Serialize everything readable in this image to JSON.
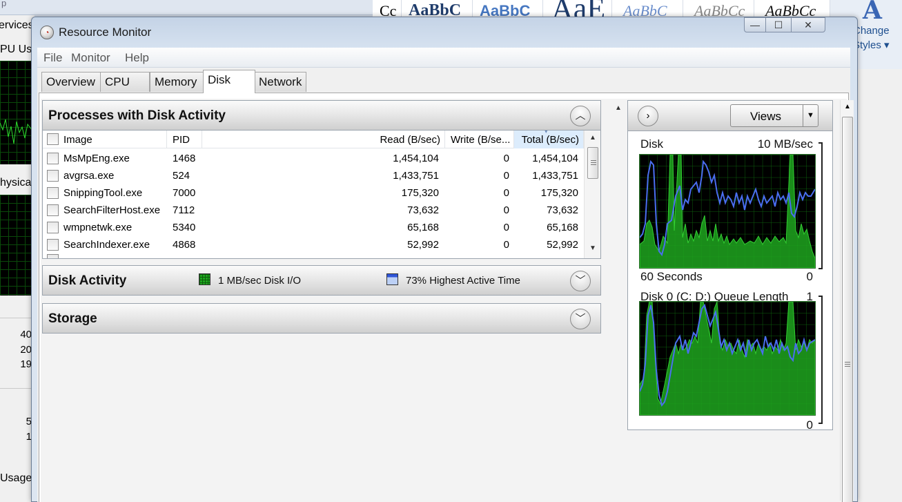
{
  "background": {
    "task_manager": {
      "tab_text": "ervices",
      "labels": [
        "PU Us",
        "hysica",
        "Usage"
      ],
      "numbers": [
        "40",
        "20",
        "19",
        "5",
        "1"
      ]
    },
    "word_ribbon": {
      "styles": [
        "Cc",
        "AaBbC",
        "AaBbC",
        "AaE",
        "AaBbC",
        "AaBbCc",
        "AaBbCc"
      ],
      "change_styles": [
        "Change",
        "Styles"
      ]
    }
  },
  "window": {
    "title": "Resource Monitor",
    "controls": {
      "minimize": "—",
      "maximize": "☐",
      "close": "✕"
    },
    "menu": [
      "File",
      "Monitor",
      "Help"
    ],
    "tabs": [
      "Overview",
      "CPU",
      "Memory",
      "Disk",
      "Network"
    ],
    "active_tab": "Disk"
  },
  "processes_panel": {
    "title": "Processes with Disk Activity",
    "columns": [
      "Image",
      "PID",
      "Read (B/sec)",
      "Write (B/se...",
      "Total (B/sec)"
    ],
    "rows": [
      {
        "image": "MsMpEng.exe",
        "pid": "1468",
        "read": "1,454,104",
        "write": "0",
        "total": "1,454,104"
      },
      {
        "image": "avgrsa.exe",
        "pid": "524",
        "read": "1,433,751",
        "write": "0",
        "total": "1,433,751"
      },
      {
        "image": "SnippingTool.exe",
        "pid": "7000",
        "read": "175,320",
        "write": "0",
        "total": "175,320"
      },
      {
        "image": "SearchFilterHost.exe",
        "pid": "7112",
        "read": "73,632",
        "write": "0",
        "total": "73,632"
      },
      {
        "image": "wmpnetwk.exe",
        "pid": "5340",
        "read": "65,168",
        "write": "0",
        "total": "65,168"
      },
      {
        "image": "SearchIndexer.exe",
        "pid": "4868",
        "read": "52,992",
        "write": "0",
        "total": "52,992"
      }
    ]
  },
  "disk_activity": {
    "title": "Disk Activity",
    "legend_io": "1 MB/sec Disk I/O",
    "legend_active": "73% Highest Active Time"
  },
  "storage": {
    "title": "Storage"
  },
  "graphs": {
    "views_label": "Views",
    "disk": {
      "title": "Disk",
      "max": "10 MB/sec",
      "duration": "60 Seconds",
      "min": "0"
    },
    "queue": {
      "title": "Disk 0 (C: D:) Queue Length",
      "max": "1",
      "min": "0"
    }
  },
  "colors": {
    "graph_fill": "#1ea51e",
    "graph_line": "#4a6ef0",
    "grid": "#0d5e0d"
  }
}
